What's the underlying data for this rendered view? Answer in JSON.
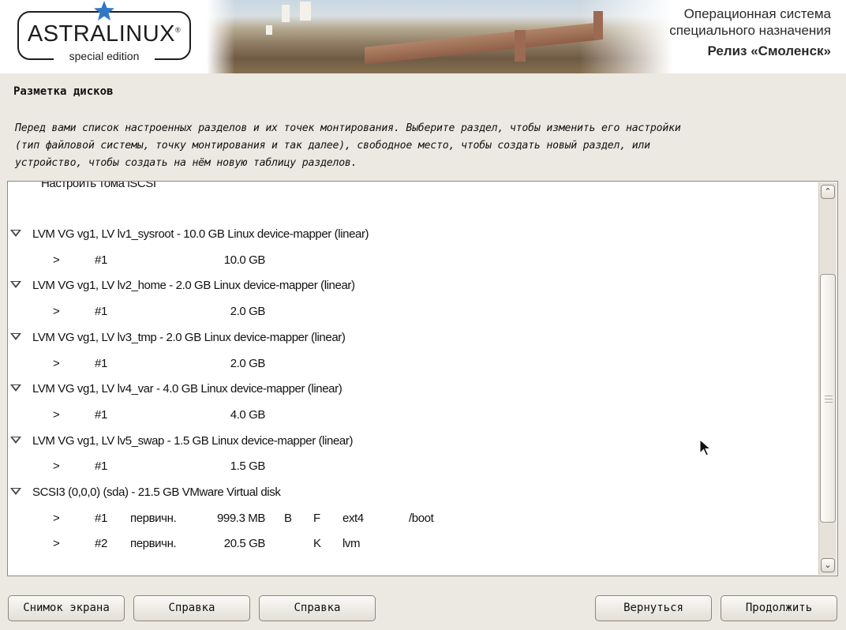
{
  "header": {
    "logo_main": "ASTRALINUX",
    "logo_registered": "®",
    "logo_sub": "special edition",
    "release_line1": "Операционная система",
    "release_line2": "специального назначения",
    "release_line3": "Релиз «Смоленск»"
  },
  "page": {
    "title": "Разметка дисков",
    "description_lines": [
      "Перед вами список настроенных разделов и их точек монтирования. Выберите раздел, чтобы изменить его настройки",
      "(тип файловой системы, точку монтирования и так далее), свободное место, чтобы создать новый раздел, или",
      "устройство, чтобы создать на нём новую таблицу разделов."
    ]
  },
  "partition_list": {
    "partial_top_item": "Настроить тома iSCSI",
    "rows": [
      {
        "type": "device",
        "text": "LVM VG vg1, LV lv1_sysroot - 10.0 GB Linux device-mapper (linear)"
      },
      {
        "type": "partition",
        "arrow": ">",
        "num": "#1",
        "kind": "",
        "size": "10.0 GB",
        "flag_b": "",
        "flag_f": "",
        "fs": "",
        "mount": ""
      },
      {
        "type": "device",
        "text": "LVM VG vg1, LV lv2_home - 2.0 GB Linux device-mapper (linear)"
      },
      {
        "type": "partition",
        "arrow": ">",
        "num": "#1",
        "kind": "",
        "size": "2.0 GB",
        "flag_b": "",
        "flag_f": "",
        "fs": "",
        "mount": ""
      },
      {
        "type": "device",
        "text": "LVM VG vg1, LV lv3_tmp - 2.0 GB Linux device-mapper (linear)"
      },
      {
        "type": "partition",
        "arrow": ">",
        "num": "#1",
        "kind": "",
        "size": "2.0 GB",
        "flag_b": "",
        "flag_f": "",
        "fs": "",
        "mount": ""
      },
      {
        "type": "device",
        "text": "LVM VG vg1, LV lv4_var - 4.0 GB Linux device-mapper (linear)"
      },
      {
        "type": "partition",
        "arrow": ">",
        "num": "#1",
        "kind": "",
        "size": "4.0 GB",
        "flag_b": "",
        "flag_f": "",
        "fs": "",
        "mount": ""
      },
      {
        "type": "device",
        "text": "LVM VG vg1, LV lv5_swap - 1.5 GB Linux device-mapper (linear)"
      },
      {
        "type": "partition",
        "arrow": ">",
        "num": "#1",
        "kind": "",
        "size": "1.5 GB",
        "flag_b": "",
        "flag_f": "",
        "fs": "",
        "mount": ""
      },
      {
        "type": "device",
        "text": "SCSI3 (0,0,0) (sda) - 21.5 GB VMware Virtual disk"
      },
      {
        "type": "partition",
        "arrow": ">",
        "num": "#1",
        "kind": "первичн.",
        "size": "999.3 MB",
        "flag_b": "B",
        "flag_f": "F",
        "fs": "ext4",
        "mount": "/boot"
      },
      {
        "type": "partition",
        "arrow": ">",
        "num": "#2",
        "kind": "первичн.",
        "size": "20.5 GB",
        "flag_b": "",
        "flag_f": "K",
        "fs": "lvm",
        "mount": ""
      }
    ]
  },
  "scrollbar": {
    "up_glyph": "⌃",
    "down_glyph": "⌄"
  },
  "buttons": {
    "screenshot": "Снимок экрана",
    "help1": "Справка",
    "help2": "Справка",
    "back": "Вернуться",
    "continue": "Продолжить"
  }
}
